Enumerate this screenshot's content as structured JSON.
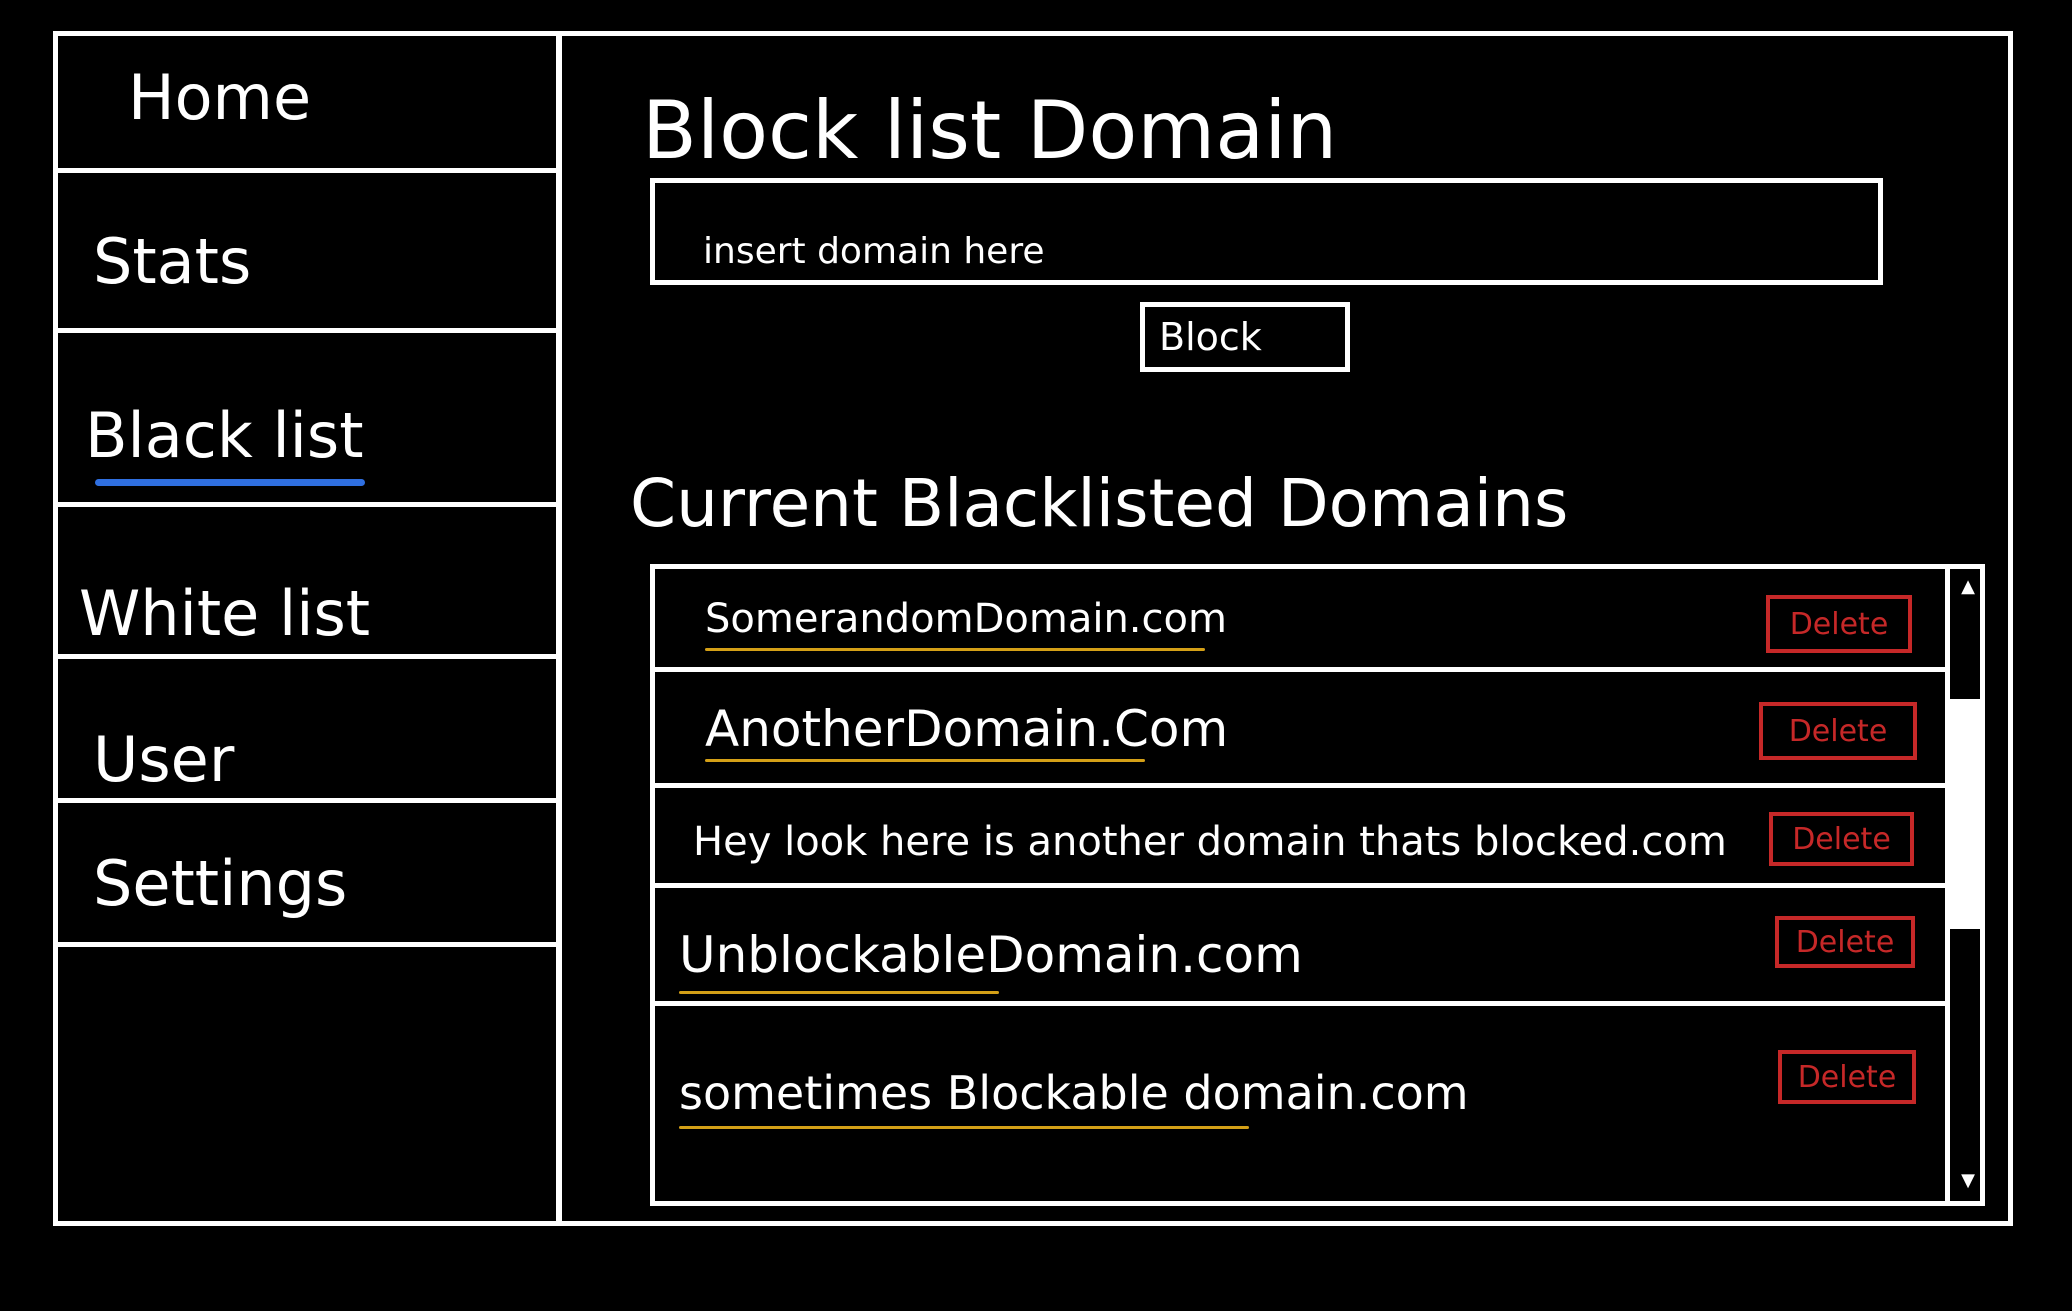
{
  "sidebar": {
    "items": [
      {
        "label": "Home"
      },
      {
        "label": "Stats"
      },
      {
        "label": "Black list"
      },
      {
        "label": "White list"
      },
      {
        "label": "User"
      },
      {
        "label": "Settings"
      }
    ],
    "active_item": "Black list"
  },
  "main": {
    "title": "Block list  Domain",
    "input": {
      "placeholder": "insert domain here",
      "value": ""
    },
    "block_button_label": "Block",
    "list_title": "Current Blacklisted Domains",
    "domains": [
      {
        "name": "SomerandomDomain.com",
        "delete_label": "Delete"
      },
      {
        "name": "AnotherDomain.Com",
        "delete_label": "Delete"
      },
      {
        "name": "Hey look here is another domain thats blocked.com",
        "delete_label": "Delete"
      },
      {
        "name": "UnblockableDomain.com",
        "delete_label": "Delete"
      },
      {
        "name": "sometimes Blockable domain.com",
        "delete_label": "Delete"
      }
    ]
  },
  "icons": {
    "scroll_up": "chevron-up-icon",
    "scroll_down": "chevron-down-icon"
  },
  "colors": {
    "background": "#000000",
    "foreground": "#ffffff",
    "active_underline": "#2f6fe0",
    "domain_underline": "#d4a017",
    "delete": "#c62828"
  }
}
